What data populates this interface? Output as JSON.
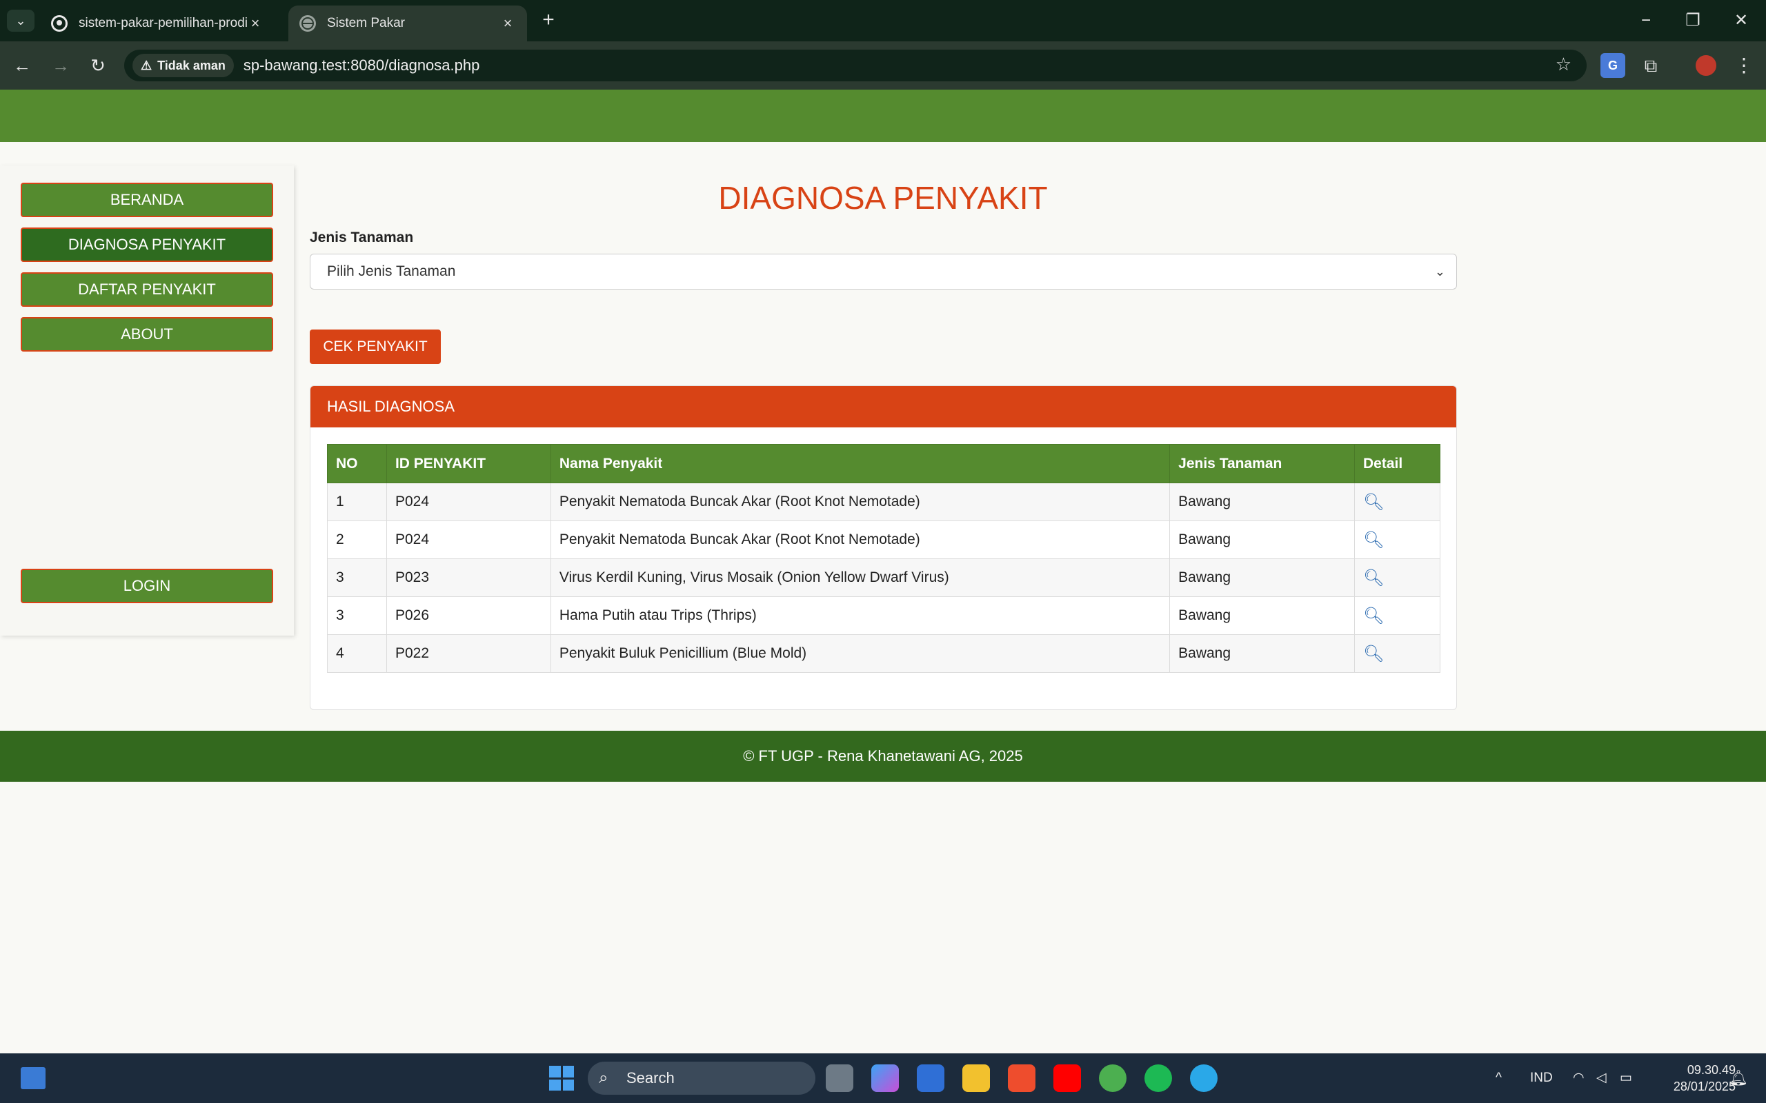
{
  "browser": {
    "tabs": [
      {
        "title": "sistem-pakar-pemilihan-prodi/",
        "active": false
      },
      {
        "title": "Sistem Pakar",
        "active": true
      }
    ],
    "security_label": "Tidak aman",
    "url": "sp-bawang.test:8080/diagnosa.php",
    "translate_glyph": "G"
  },
  "sidebar": {
    "items": [
      {
        "label": "BERANDA",
        "active": false
      },
      {
        "label": "DIAGNOSA PENYAKIT",
        "active": true
      },
      {
        "label": "DAFTAR PENYAKIT",
        "active": false
      },
      {
        "label": "ABOUT",
        "active": false
      }
    ],
    "login_label": "LOGIN"
  },
  "main": {
    "title": "DIAGNOSA PENYAKIT",
    "field_label": "Jenis Tanaman",
    "select_value": "Pilih Jenis Tanaman",
    "check_button": "CEK PENYAKIT",
    "result_title": "HASIL DIAGNOSA",
    "table": {
      "headers": [
        "NO",
        "ID PENYAKIT",
        "Nama Penyakit",
        "Jenis Tanaman",
        "Detail"
      ],
      "rows": [
        [
          "1",
          "P024",
          "Penyakit Nematoda Buncak Akar (Root Knot Nemotade)",
          "Bawang"
        ],
        [
          "2",
          "P024",
          "Penyakit Nematoda Buncak Akar (Root Knot Nemotade)",
          "Bawang"
        ],
        [
          "3",
          "P023",
          "Virus Kerdil Kuning, Virus Mosaik (Onion Yellow Dwarf Virus)",
          "Bawang"
        ],
        [
          "3",
          "P026",
          "Hama Putih atau Trips (Thrips)",
          "Bawang"
        ],
        [
          "4",
          "P022",
          "Penyakit Buluk Penicillium (Blue Mold)",
          "Bawang"
        ]
      ],
      "detail_icon": "search-icon"
    }
  },
  "footer": {
    "text": "© FT UGP - Rena Khanetawani AG, 2025"
  },
  "taskbar": {
    "search_label": "Search",
    "language": "IND",
    "time": "09.30.49",
    "date": "28/01/2025"
  },
  "colors": {
    "primary_green": "#558b2f",
    "dark_green": "#33691e",
    "accent_orange": "#d84315",
    "link_blue": "#2a6ab0"
  }
}
